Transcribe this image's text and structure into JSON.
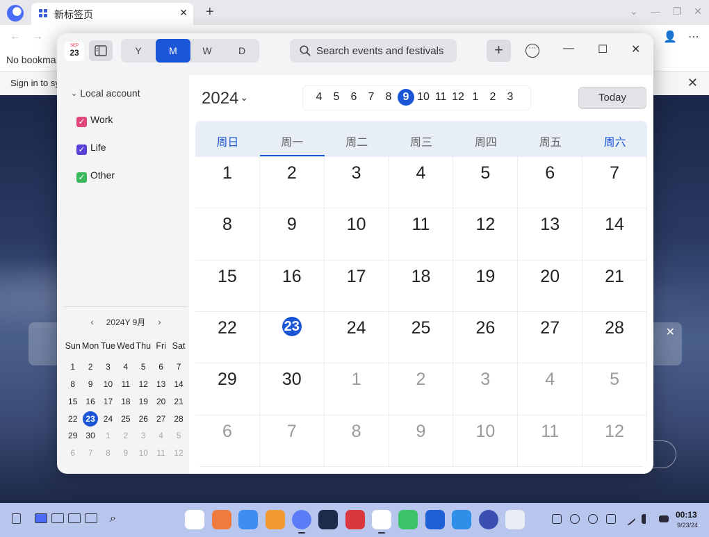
{
  "browser": {
    "tab_title": "新标签页",
    "bookmark_bar_text": "No bookma",
    "signin_text": "Sign in to sy"
  },
  "calendar": {
    "app_icon": {
      "month": "SEP",
      "day": "23"
    },
    "views": [
      "Y",
      "M",
      "W",
      "D"
    ],
    "active_view": "M",
    "search": {
      "placeholder": "Search events and festivals"
    },
    "sidebar": {
      "account_label": "Local account",
      "calendars": [
        {
          "label": "Work",
          "color": "#e0457b"
        },
        {
          "label": "Life",
          "color": "#5a3fd6"
        },
        {
          "label": "Other",
          "color": "#3bb85a"
        }
      ],
      "mini": {
        "title": "2024Y 9月",
        "weekdays": [
          "Sun",
          "Mon",
          "Tue",
          "Wed",
          "Thu",
          "Fri",
          "Sat"
        ],
        "weeks": [
          [
            "1",
            "2",
            "3",
            "4",
            "5",
            "6",
            "7"
          ],
          [
            "8",
            "9",
            "10",
            "11",
            "12",
            "13",
            "14"
          ],
          [
            "15",
            "16",
            "17",
            "18",
            "19",
            "20",
            "21"
          ],
          [
            "22",
            "23",
            "24",
            "25",
            "26",
            "27",
            "28"
          ],
          [
            "29",
            "30",
            "1",
            "2",
            "3",
            "4",
            "5"
          ],
          [
            "6",
            "7",
            "8",
            "9",
            "10",
            "11",
            "12"
          ]
        ]
      }
    },
    "year": "2024",
    "months": [
      "4",
      "5",
      "6",
      "7",
      "8",
      "9",
      "10",
      "11",
      "12",
      "1",
      "2",
      "3"
    ],
    "active_month": "9",
    "today_label": "Today",
    "weekdays": [
      "周日",
      "周一",
      "周二",
      "周三",
      "周四",
      "周五",
      "周六"
    ],
    "weeks": [
      [
        "1",
        "2",
        "3",
        "4",
        "5",
        "6",
        "7"
      ],
      [
        "8",
        "9",
        "10",
        "11",
        "12",
        "13",
        "14"
      ],
      [
        "15",
        "16",
        "17",
        "18",
        "19",
        "20",
        "21"
      ],
      [
        "22",
        "23",
        "24",
        "25",
        "26",
        "27",
        "28"
      ],
      [
        "29",
        "30",
        "1",
        "2",
        "3",
        "4",
        "5"
      ],
      [
        "6",
        "7",
        "8",
        "9",
        "10",
        "11",
        "12"
      ]
    ],
    "today": "23",
    "accent_color": "#1a56d6"
  },
  "taskbar": {
    "time": "00:13",
    "date": "9/23/24"
  }
}
